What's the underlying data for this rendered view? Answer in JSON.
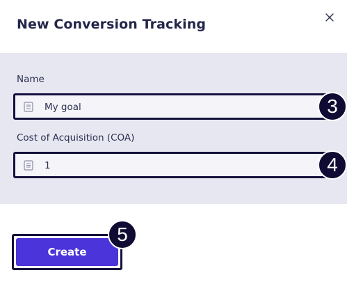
{
  "dialog": {
    "title": "New Conversion Tracking",
    "close_icon": "close-icon"
  },
  "form": {
    "name": {
      "label": "Name",
      "value": "My goal",
      "icon": "text-field-icon"
    },
    "coa": {
      "label": "Cost of Acquisition (COA)",
      "value": "1",
      "icon": "text-field-icon"
    }
  },
  "actions": {
    "create_label": "Create"
  },
  "step_markers": {
    "name": "3",
    "coa": "4",
    "create": "5"
  },
  "colors": {
    "accent": "#4b34d9",
    "panel": "#e7e7f1",
    "marker": "#0f0b33"
  }
}
